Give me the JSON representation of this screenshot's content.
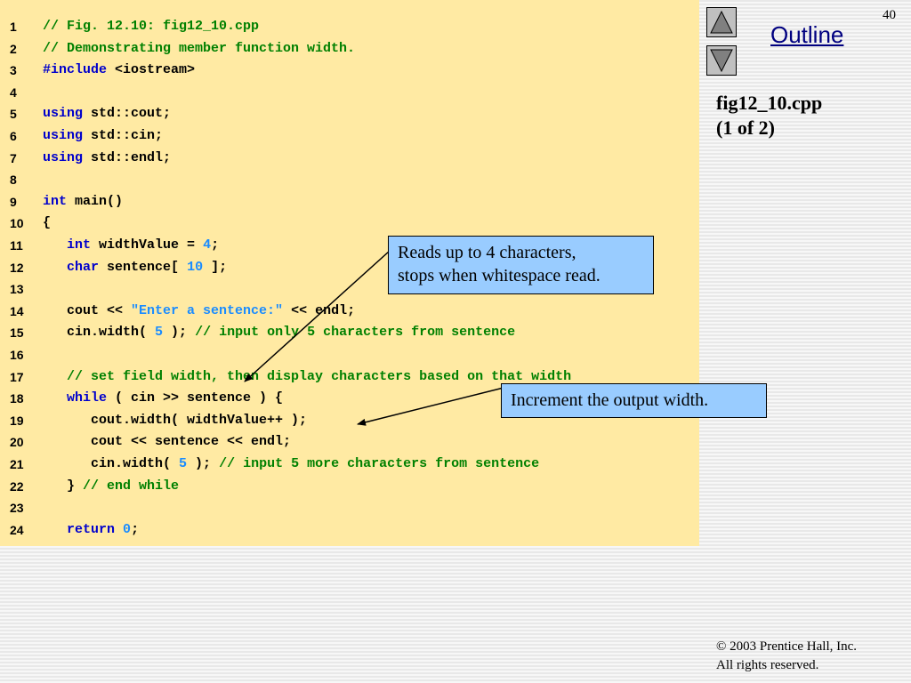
{
  "slide": {
    "page_number": "40",
    "outline_label": "Outline",
    "file_title": "fig12_10.cpp",
    "file_part": "(1 of 2)",
    "copyright_line1": "© 2003 Prentice Hall, Inc.",
    "copyright_line2": "All rights reserved.",
    "nav": {
      "up_icon": "triangle-up-icon",
      "down_icon": "triangle-down-icon"
    }
  },
  "colors": {
    "code_background": "#ffeaa3",
    "comment": "#008000",
    "keyword": "#0000cc",
    "literal": "#1a8cff",
    "callout_background": "#99ccff",
    "outline_link": "#000080"
  },
  "code_lines": [
    {
      "n": "1",
      "tokens": [
        {
          "t": "// Fig. 12.10: fig12_10.cpp",
          "c": "comment"
        }
      ]
    },
    {
      "n": "2",
      "tokens": [
        {
          "t": "// Demonstrating member function width.",
          "c": "comment"
        }
      ]
    },
    {
      "n": "3",
      "tokens": [
        {
          "t": "#include",
          "c": "keyword"
        },
        {
          "t": " <iostream>",
          "c": "plain"
        }
      ]
    },
    {
      "n": "4",
      "tokens": []
    },
    {
      "n": "5",
      "tokens": [
        {
          "t": "using",
          "c": "keyword"
        },
        {
          "t": " std::cout;",
          "c": "plain"
        }
      ]
    },
    {
      "n": "6",
      "tokens": [
        {
          "t": "using",
          "c": "keyword"
        },
        {
          "t": " std::cin;",
          "c": "plain"
        }
      ]
    },
    {
      "n": "7",
      "tokens": [
        {
          "t": "using",
          "c": "keyword"
        },
        {
          "t": " std::endl;",
          "c": "plain"
        }
      ]
    },
    {
      "n": "8",
      "tokens": []
    },
    {
      "n": "9",
      "tokens": [
        {
          "t": "int",
          "c": "keyword"
        },
        {
          "t": " main()",
          "c": "plain"
        }
      ]
    },
    {
      "n": "10",
      "tokens": [
        {
          "t": "{",
          "c": "plain"
        }
      ]
    },
    {
      "n": "11",
      "tokens": [
        {
          "t": "   ",
          "c": "plain"
        },
        {
          "t": "int",
          "c": "keyword"
        },
        {
          "t": " widthValue = ",
          "c": "plain"
        },
        {
          "t": "4",
          "c": "number"
        },
        {
          "t": ";",
          "c": "plain"
        }
      ]
    },
    {
      "n": "12",
      "tokens": [
        {
          "t": "   ",
          "c": "plain"
        },
        {
          "t": "char",
          "c": "keyword"
        },
        {
          "t": " sentence[ ",
          "c": "plain"
        },
        {
          "t": "10",
          "c": "number"
        },
        {
          "t": " ];",
          "c": "plain"
        }
      ]
    },
    {
      "n": "13",
      "tokens": []
    },
    {
      "n": "14",
      "tokens": [
        {
          "t": "   cout << ",
          "c": "plain"
        },
        {
          "t": "\"Enter a sentence:\"",
          "c": "string"
        },
        {
          "t": " << endl;",
          "c": "plain"
        }
      ]
    },
    {
      "n": "15",
      "tokens": [
        {
          "t": "   cin.width( ",
          "c": "plain"
        },
        {
          "t": "5",
          "c": "number"
        },
        {
          "t": " ); ",
          "c": "plain"
        },
        {
          "t": "// input only 5 characters from sentence",
          "c": "comment"
        }
      ]
    },
    {
      "n": "16",
      "tokens": []
    },
    {
      "n": "17",
      "tokens": [
        {
          "t": "   ",
          "c": "plain"
        },
        {
          "t": "// set field width, then display characters based on that width",
          "c": "comment"
        }
      ]
    },
    {
      "n": "18",
      "tokens": [
        {
          "t": "   ",
          "c": "plain"
        },
        {
          "t": "while",
          "c": "keyword"
        },
        {
          "t": " ( cin >> sentence ) {",
          "c": "plain"
        }
      ]
    },
    {
      "n": "19",
      "tokens": [
        {
          "t": "      cout.width( widthValue++ );",
          "c": "plain"
        }
      ]
    },
    {
      "n": "20",
      "tokens": [
        {
          "t": "      cout << sentence << endl;",
          "c": "plain"
        }
      ]
    },
    {
      "n": "21",
      "tokens": [
        {
          "t": "      cin.width( ",
          "c": "plain"
        },
        {
          "t": "5",
          "c": "number"
        },
        {
          "t": " ); ",
          "c": "plain"
        },
        {
          "t": "// input 5 more characters from sentence",
          "c": "comment"
        }
      ]
    },
    {
      "n": "22",
      "tokens": [
        {
          "t": "   } ",
          "c": "plain"
        },
        {
          "t": "// end while",
          "c": "comment"
        }
      ]
    },
    {
      "n": "23",
      "tokens": []
    },
    {
      "n": "24",
      "tokens": [
        {
          "t": "   ",
          "c": "plain"
        },
        {
          "t": "return",
          "c": "keyword"
        },
        {
          "t": " ",
          "c": "plain"
        },
        {
          "t": "0",
          "c": "number"
        },
        {
          "t": ";",
          "c": "plain"
        }
      ]
    }
  ],
  "callouts": {
    "reads_line1": "Reads up to 4 characters,",
    "reads_line2": "stops when whitespace read.",
    "increment": "Increment the output width."
  }
}
